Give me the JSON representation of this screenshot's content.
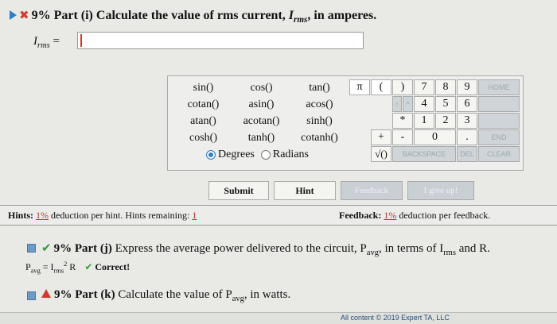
{
  "part_i": {
    "title_prefix": "9% Part (i)",
    "title_text": "Calculate the value of rms current,",
    "var_main": "I",
    "var_sub": "rms",
    "title_suffix": ", in amperes.",
    "answer_label_main": "I",
    "answer_label_sub": "rms",
    "answer_label_eq": " =",
    "answer_value": ""
  },
  "calc": {
    "functions": [
      [
        "sin()",
        "cos()",
        "tan()"
      ],
      [
        "cotan()",
        "asin()",
        "acos()"
      ],
      [
        "atan()",
        "acotan()",
        "sinh()"
      ],
      [
        "cosh()",
        "tanh()",
        "cotanh()"
      ]
    ],
    "degrees_label": "Degrees",
    "radians_label": "Radians",
    "keys": {
      "pi": "π",
      "lparen": "(",
      "rparen": ")",
      "k7": "7",
      "k8": "8",
      "k9": "9",
      "home": "HOME",
      "up": "↑",
      "left": "^",
      "k4": "4",
      "k5": "5",
      "k6": "6",
      "mult": "*",
      "k1": "1",
      "k2": "2",
      "k3": "3",
      "plus": "+",
      "minus": "-",
      "k0": "0",
      "dot": ".",
      "end": "END",
      "sqrt": "√()",
      "backspace": "BACKSPACE",
      "del": "DEL",
      "clear": "CLEAR"
    }
  },
  "buttons": {
    "submit": "Submit",
    "hint": "Hint",
    "feedback": "Feedback",
    "give_up": "I give up!"
  },
  "hints": {
    "label": "Hints:",
    "pct": "1%",
    "text": " deduction per hint. Hints remaining:",
    "remaining": "1"
  },
  "feedback": {
    "label": "Feedback:",
    "pct": "1%",
    "text": " deduction per feedback."
  },
  "part_j": {
    "title_prefix": "9% Part (j)",
    "title_text": "Express the average power delivered to the circuit, P",
    "sub1": "avg",
    "mid": ", in terms of I",
    "sub2": "rms",
    "end": " and R.",
    "eq_p": "P",
    "eq_p_sub": "avg",
    "eq_mid": " = I",
    "eq_i_sub": "rms",
    "eq_sup": "2",
    "eq_end": " R",
    "correct": "Correct!"
  },
  "part_k": {
    "title_prefix": "9% Part (k)",
    "title_text": "Calculate the value of P",
    "sub": "avg",
    "end": ", in watts."
  },
  "footer": "All content © 2019 Expert TA, LLC",
  "colors": {
    "accent_blue": "#2f7fc4",
    "error_red": "#d23a2e",
    "success_green": "#3a9a3a"
  }
}
